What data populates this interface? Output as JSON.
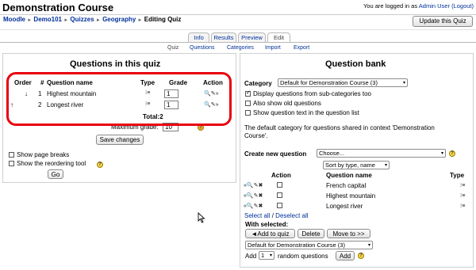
{
  "header": {
    "title": "Demonstration Course",
    "login_prefix": "You are logged in as",
    "login_user": "Admin User",
    "logout": "(Logout)",
    "update_button": "Update this Quiz"
  },
  "breadcrumb": [
    "Moodle",
    "Demo101",
    "Quizzes",
    "Geography",
    "Editing Quiz"
  ],
  "tabs": [
    "Info",
    "Results",
    "Preview",
    "Edit"
  ],
  "subtabs": [
    "Quiz",
    "Questions",
    "Categories",
    "Import",
    "Export"
  ],
  "quiz": {
    "heading": "Questions in this quiz",
    "columns": [
      "Order",
      "#",
      "Question name",
      "Type",
      "Grade",
      "Action"
    ],
    "rows": [
      {
        "order": "↓",
        "num": "1",
        "name": "Highest mountain",
        "grade": "1"
      },
      {
        "order": "↑",
        "num": "2",
        "name": "Longest river",
        "grade": "1"
      }
    ],
    "total_label": "Total:",
    "total_value": "2",
    "max_grade_label": "Maximum grade:",
    "max_grade_value": "10",
    "save_button": "Save changes",
    "show_page_breaks": "Show page breaks",
    "show_reorder": "Show the reordering tool",
    "go_button": "Go"
  },
  "bank": {
    "heading": "Question bank",
    "category_label": "Category",
    "category_value": "Default for Demonstration Course (3)",
    "opt_subcategories": "Display questions from sub-categories too",
    "opt_old": "Also show old questions",
    "opt_text": "Show question text in the question list",
    "description": "The default category for questions shared in context 'Demonstration Course'.",
    "create_label": "Create new question",
    "create_value": "Choose...",
    "sort_value": "Sort by type, name",
    "columns": [
      "Action",
      "Question name",
      "Type"
    ],
    "questions": [
      "French capital",
      "Highest mountain",
      "Longest river"
    ],
    "select_all": "Select all",
    "separator": "/",
    "deselect_all": "Deselect all",
    "with_selected": "With selected:",
    "add_to_quiz": "◄Add to quiz",
    "delete": "Delete",
    "move_to": "Move to >>",
    "move_category": "Default for Demonstration Course (3)",
    "add_label": "Add",
    "random_count": "1",
    "random_label": "random questions",
    "add_button": "Add"
  },
  "colors": {
    "link": "#00309a",
    "highlight": "#e8000e",
    "panel_border": "#cfcfcf"
  }
}
